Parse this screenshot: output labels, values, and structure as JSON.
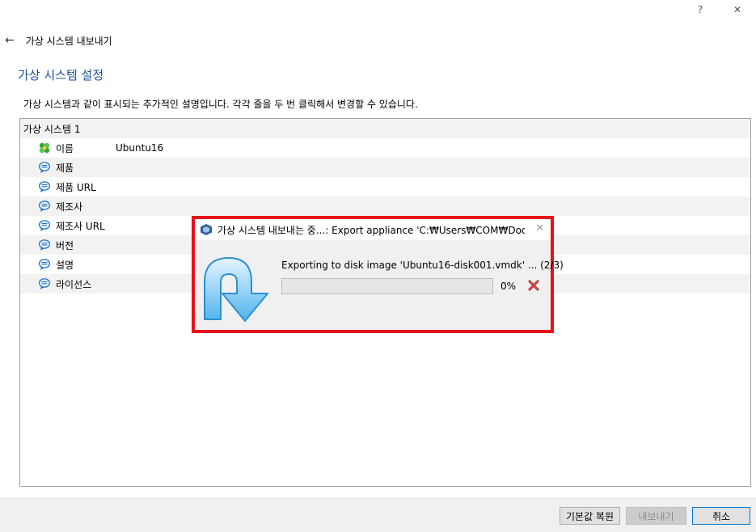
{
  "window": {
    "help_glyph": "?",
    "close_glyph": "✕"
  },
  "header": {
    "back_glyph": "←",
    "title": "가상 시스템 내보내기"
  },
  "section": {
    "title": "가상 시스템 설정",
    "description": "가상 시스템과 같이 표시되는 추가적인 설명입니다. 각각 줄을 두 번 클릭해서 변경할 수 있습니다."
  },
  "table": {
    "group_label": "가상 시스템 1",
    "rows": [
      {
        "icon": "os-icon",
        "label": "이름",
        "value": "Ubuntu16"
      },
      {
        "icon": "description-icon",
        "label": "제품",
        "value": ""
      },
      {
        "icon": "description-icon",
        "label": "제품 URL",
        "value": ""
      },
      {
        "icon": "description-icon",
        "label": "제조사",
        "value": ""
      },
      {
        "icon": "description-icon",
        "label": "제조사 URL",
        "value": ""
      },
      {
        "icon": "description-icon",
        "label": "버전",
        "value": ""
      },
      {
        "icon": "description-icon",
        "label": "설명",
        "value": ""
      },
      {
        "icon": "description-icon",
        "label": "라이선스",
        "value": ""
      }
    ]
  },
  "dialog": {
    "title": "가상 시스템 내보내는 중...: Export appliance 'C:₩Users₩COM₩Docu...",
    "close_glyph": "✕",
    "message": "Exporting to disk image 'Ubuntu16-disk001.vmdk' ... (2/3)",
    "progress_percent": 0,
    "progress_label": "0%",
    "highlight_color": "#e8101a"
  },
  "footer": {
    "restore_defaults_label": "기본값 복원",
    "export_label": "내보내기",
    "cancel_label": "취소"
  },
  "colors": {
    "section_title": "#1a4f9c",
    "alt_row": "#f2f2f2"
  }
}
